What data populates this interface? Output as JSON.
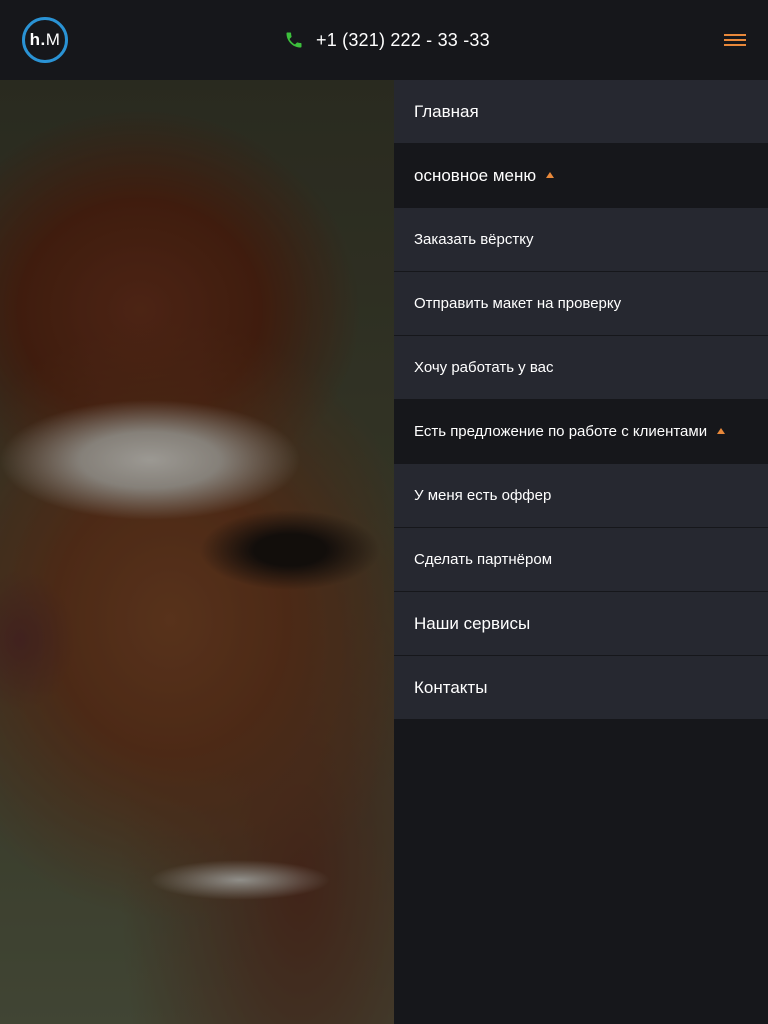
{
  "header": {
    "logo": {
      "bold": "h.",
      "rest": "M"
    },
    "phone": {
      "icon": "phone-icon",
      "number": "+1 (321) 222 - 33 -33",
      "icon_color": "#3cbf3c"
    },
    "menu_button": {
      "icon": "hamburger-icon",
      "color": "#e8883a"
    }
  },
  "hero": {
    "image": "alpaca-closeup-photo"
  },
  "menu": {
    "items": [
      {
        "label": "Главная"
      },
      {
        "label": "основное меню"
      },
      {
        "label": "Заказать вёрстку"
      },
      {
        "label": "Отправить макет на проверку"
      },
      {
        "label": "Хочу работать у вас"
      },
      {
        "label": "Есть предложение по работе с клиентами"
      },
      {
        "label": "У меня есть оффер"
      },
      {
        "label": "Сделать партнёром"
      },
      {
        "label": "Наши сервисы"
      },
      {
        "label": "Контакты"
      }
    ]
  },
  "colors": {
    "accent": "#e8883a",
    "logo_ring": "#2a93d5",
    "background": "#16171b",
    "menu_item_bg": "#262830"
  }
}
